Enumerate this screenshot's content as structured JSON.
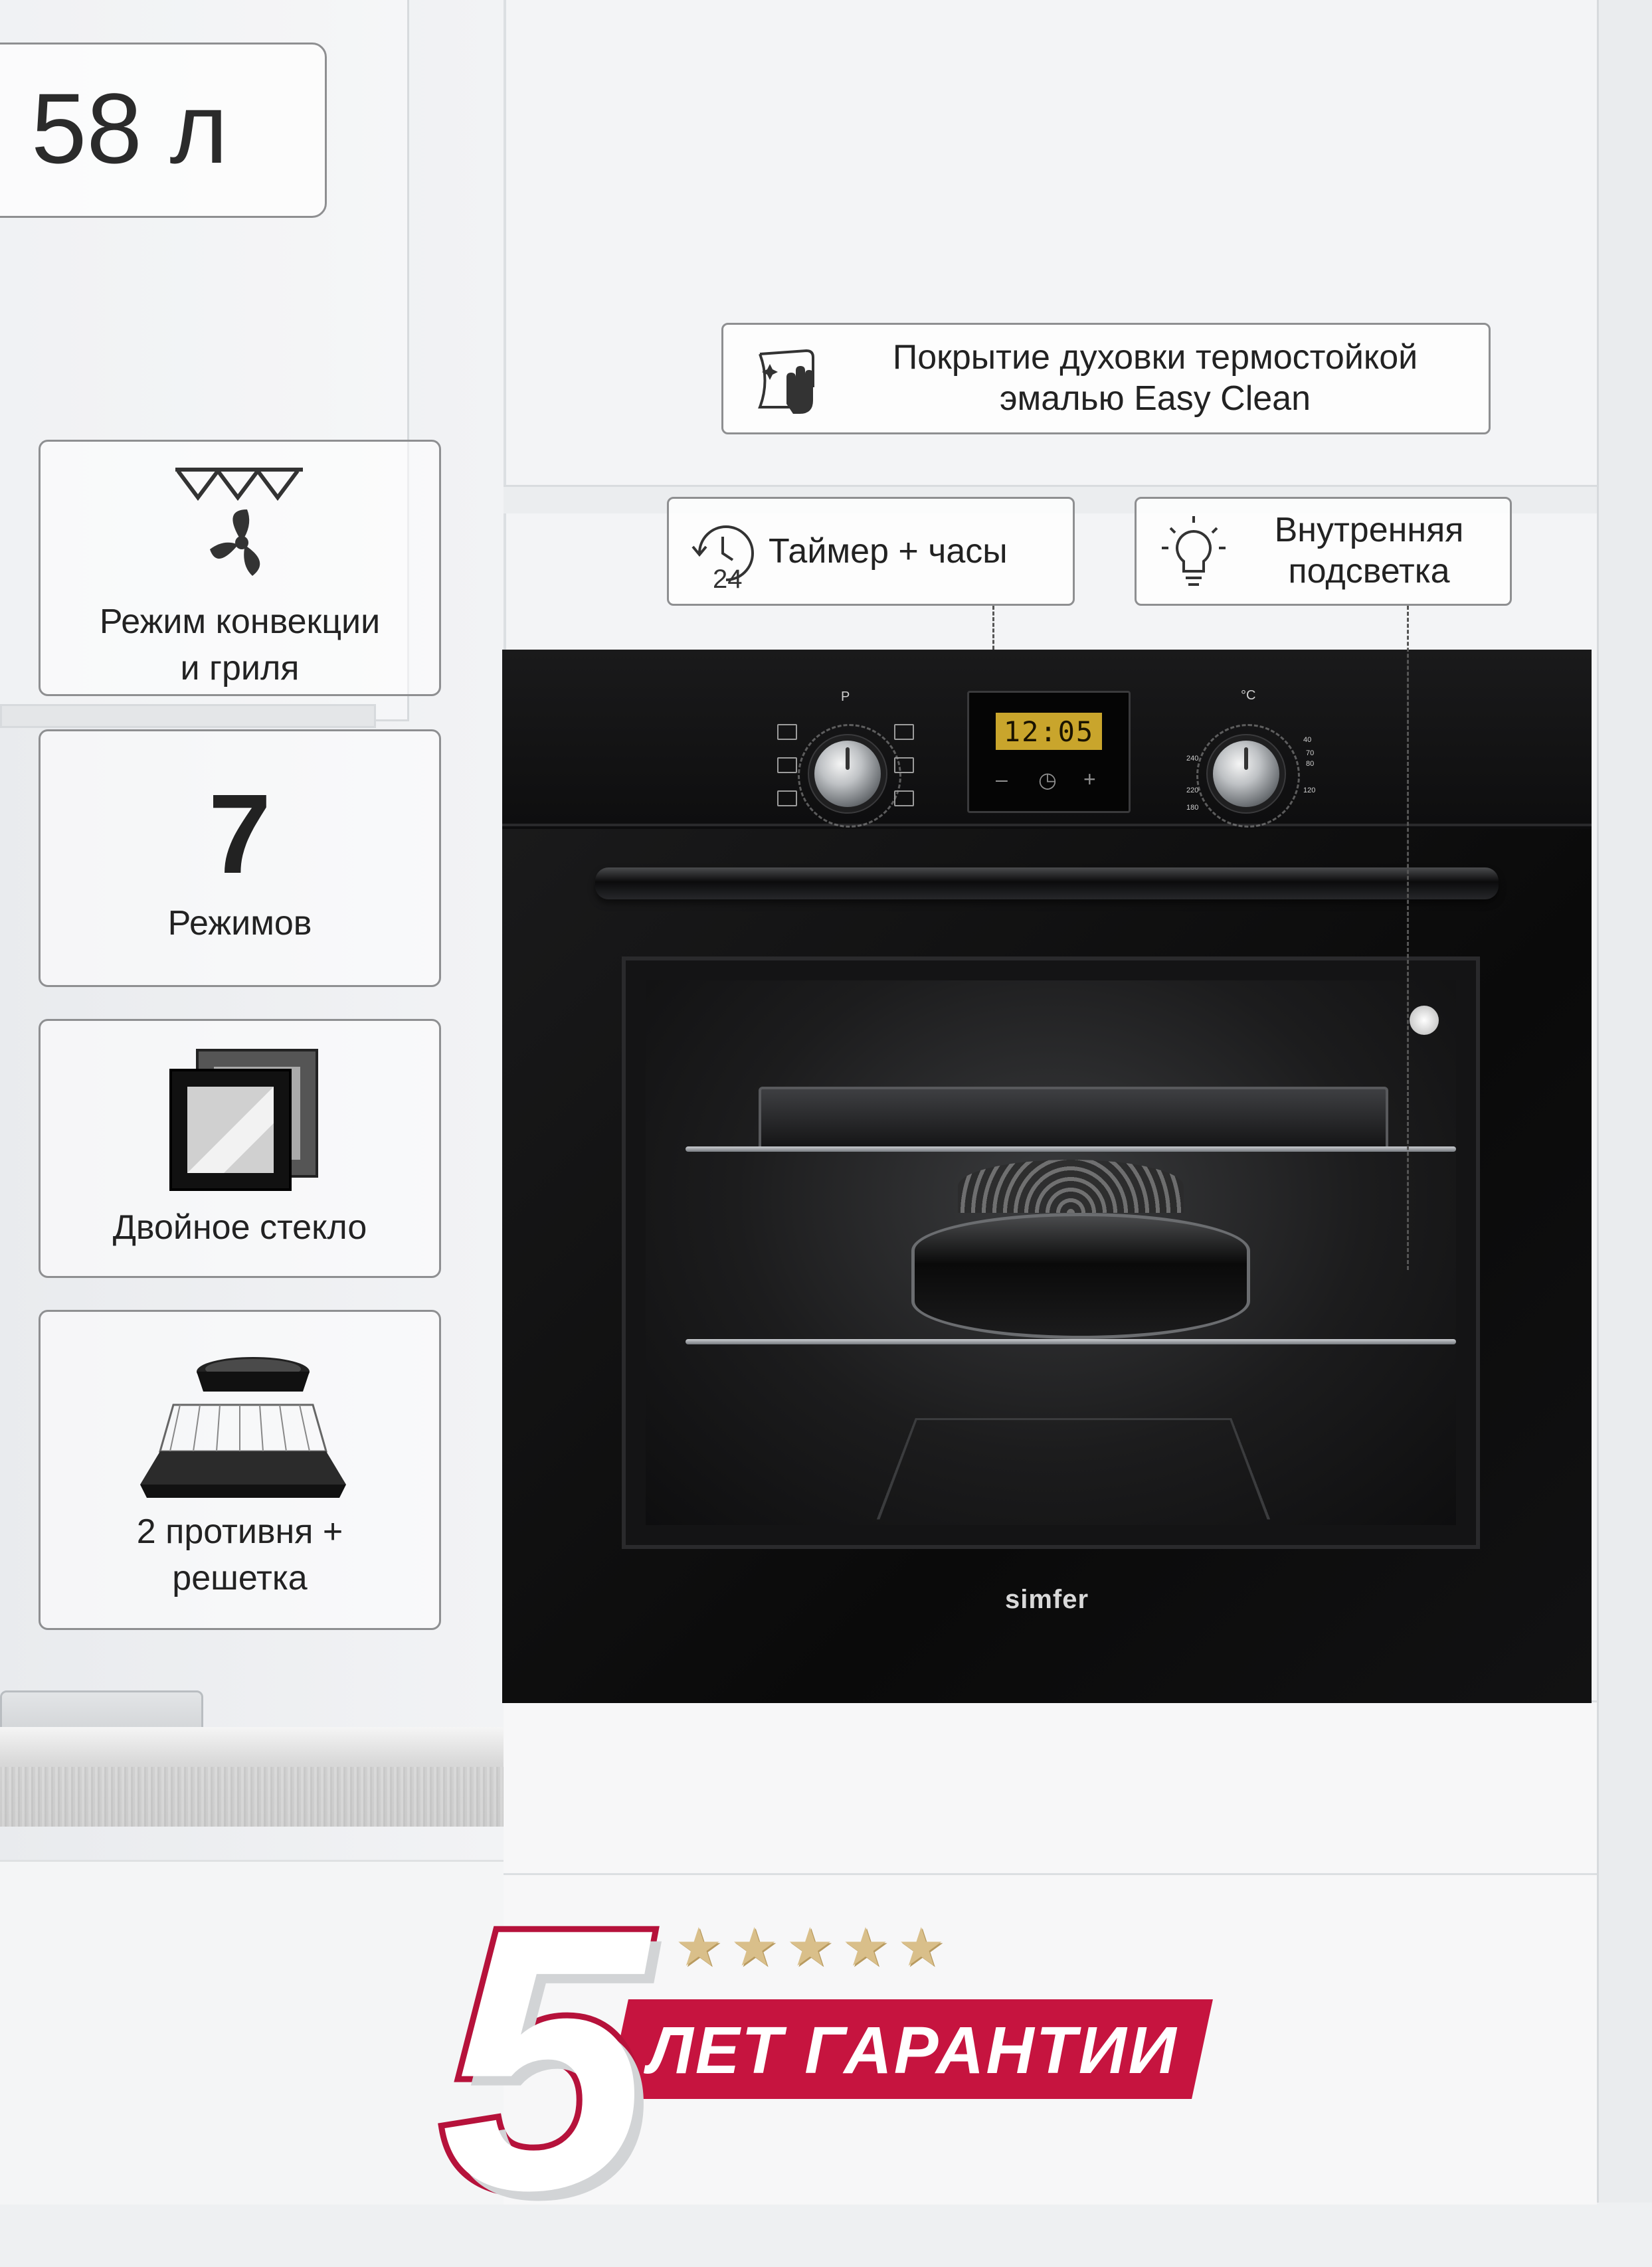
{
  "volume": {
    "label": "58 л"
  },
  "features": {
    "coating": "Покрытие духовки термостойкой\nэмалью Easy Clean",
    "timer": "Таймер + часы",
    "light": "Внутренняя\nподсветка"
  },
  "side_cards": [
    {
      "label": "Режим конвекции\nи гриля",
      "icon": "convection-grill-icon"
    },
    {
      "value": "7",
      "label": "Режимов"
    },
    {
      "label": "Двойное стекло",
      "icon": "double-glass-icon"
    },
    {
      "label": "2 противня +\nрешетка",
      "icon": "trays-rack-icon"
    }
  ],
  "oven": {
    "brand": "simfer",
    "display_time": "12:05",
    "program_label": "P",
    "temp_label": "°C",
    "temps": [
      "40",
      "70",
      "80",
      "120",
      "180",
      "220",
      "240"
    ],
    "display_buttons": [
      "–",
      "◷",
      "+"
    ]
  },
  "warranty": {
    "number": "5",
    "text": "ЛЕТ ГАРАНТИИ",
    "stars": "★★★★★"
  },
  "colors": {
    "accent": "#c6143f",
    "oven": "#0d0d0e",
    "display": "#c9a52c"
  }
}
